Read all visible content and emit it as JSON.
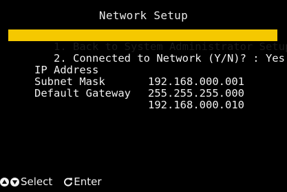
{
  "title": "Network Setup",
  "menu": [
    {
      "num": "1.",
      "label": "Back to System Administrator Setup",
      "selected": true
    },
    {
      "num": "2.",
      "label": "Connected to Network (Y/N)? : Yes",
      "selected": false
    }
  ],
  "network": [
    {
      "key": "IP Address",
      "value": "192.168.000.001"
    },
    {
      "key": "Subnet Mask",
      "value": "255.255.255.000"
    },
    {
      "key": "Default Gateway",
      "value": "192.168.000.010"
    }
  ],
  "footer": {
    "select_label": "Select",
    "enter_label": "Enter",
    "up_icon": "up-arrow-circle-icon",
    "down_icon": "down-arrow-circle-icon",
    "enter_icon": "rotate-arrow-icon"
  },
  "colors": {
    "background": "#000000",
    "text": "#f0f0f0",
    "highlight": "#f5c800"
  }
}
